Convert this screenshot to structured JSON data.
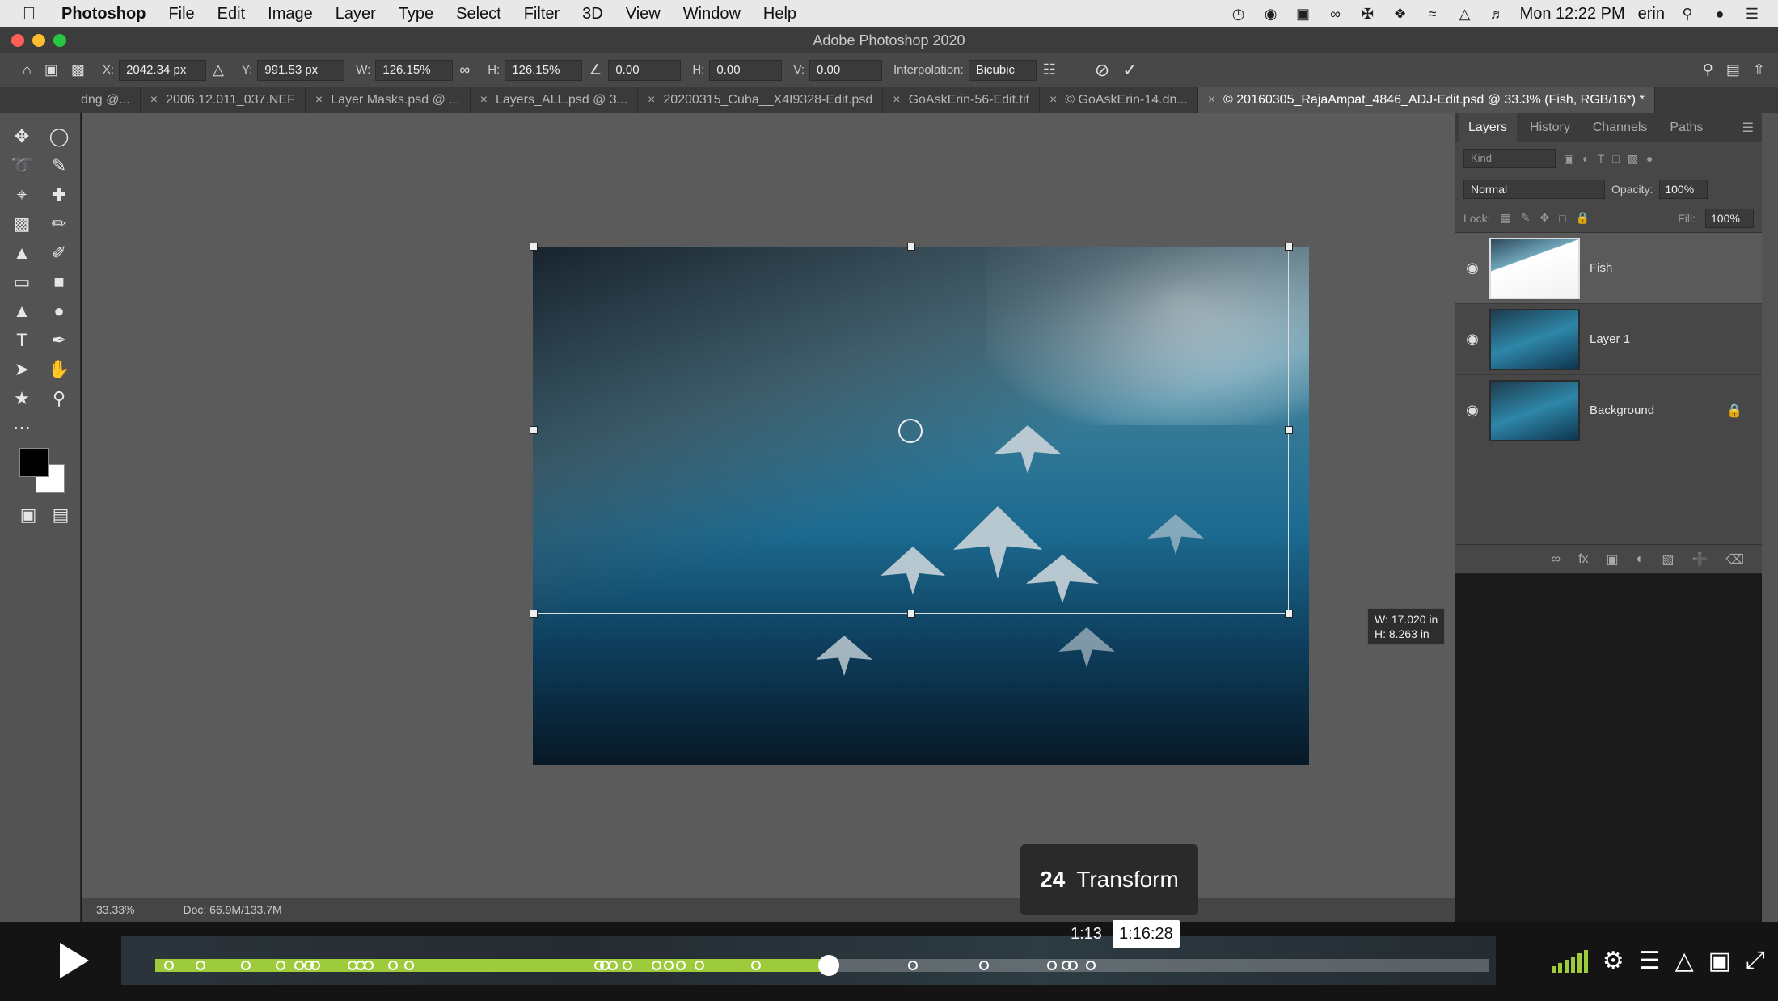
{
  "menubar": {
    "apple_icon": "apple-icon",
    "app_name": "Photoshop",
    "menus": [
      "File",
      "Edit",
      "Image",
      "Layer",
      "Type",
      "Select",
      "Filter",
      "3D",
      "View",
      "Window",
      "Help"
    ],
    "clock": "Mon 12:22 PM",
    "user": "erin"
  },
  "window": {
    "title": "Adobe Photoshop 2020"
  },
  "options_bar": {
    "x_label": "X:",
    "x_value": "2042.34 px",
    "y_label": "Y:",
    "y_value": "991.53 px",
    "w_label": "W:",
    "w_value": "126.15%",
    "h_label": "H:",
    "h_value": "126.15%",
    "angle_value": "0.00",
    "hskew_label": "H:",
    "hskew_value": "0.00",
    "vskew_label": "V:",
    "vskew_value": "0.00",
    "interpolation_label": "Interpolation:",
    "interpolation_value": "Bicubic"
  },
  "doc_tabs": [
    "dng @...",
    "2006.12.011_037.NEF",
    "Layer Masks.psd @ ...",
    "Layers_ALL.psd @ 3...",
    "20200315_Cuba__X4I9328-Edit.psd",
    "GoAskErin-56-Edit.tif",
    "© GoAskErin-14.dn...",
    "© 20160305_RajaAmpat_4846_ADJ-Edit.psd @ 33.3% (Fish, RGB/16*) *"
  ],
  "transform_tooltip": {
    "w": "W: 17.020 in",
    "h": "H: 8.263 in"
  },
  "status_bar": {
    "zoom": "33.33%",
    "doc": "Doc: 66.9M/133.7M"
  },
  "layers_panel": {
    "tabs": [
      "Layers",
      "History",
      "Channels",
      "Paths"
    ],
    "kind_placeholder": "Kind",
    "blend_mode": "Normal",
    "opacity_label": "Opacity:",
    "opacity_value": "100%",
    "lock_label": "Lock:",
    "fill_label": "Fill:",
    "fill_value": "100%",
    "layers": [
      {
        "name": "Fish",
        "selected": true
      },
      {
        "name": "Layer 1",
        "selected": false
      },
      {
        "name": "Background",
        "selected": false,
        "locked": true
      }
    ]
  },
  "player": {
    "chapter_number": "24",
    "chapter_title": "Transform",
    "hover_time_partial": "1:13",
    "hover_time": "1:16:28",
    "progress": 0.505,
    "accent": "#9ecb3c",
    "chapter_markers": [
      0.01,
      0.034,
      0.068,
      0.094,
      0.108,
      0.115,
      0.12,
      0.148,
      0.154,
      0.16,
      0.178,
      0.19,
      0.333,
      0.337,
      0.343,
      0.354,
      0.376,
      0.385,
      0.394,
      0.408,
      0.45,
      0.568,
      0.621,
      0.672,
      0.683,
      0.688,
      0.701
    ]
  }
}
